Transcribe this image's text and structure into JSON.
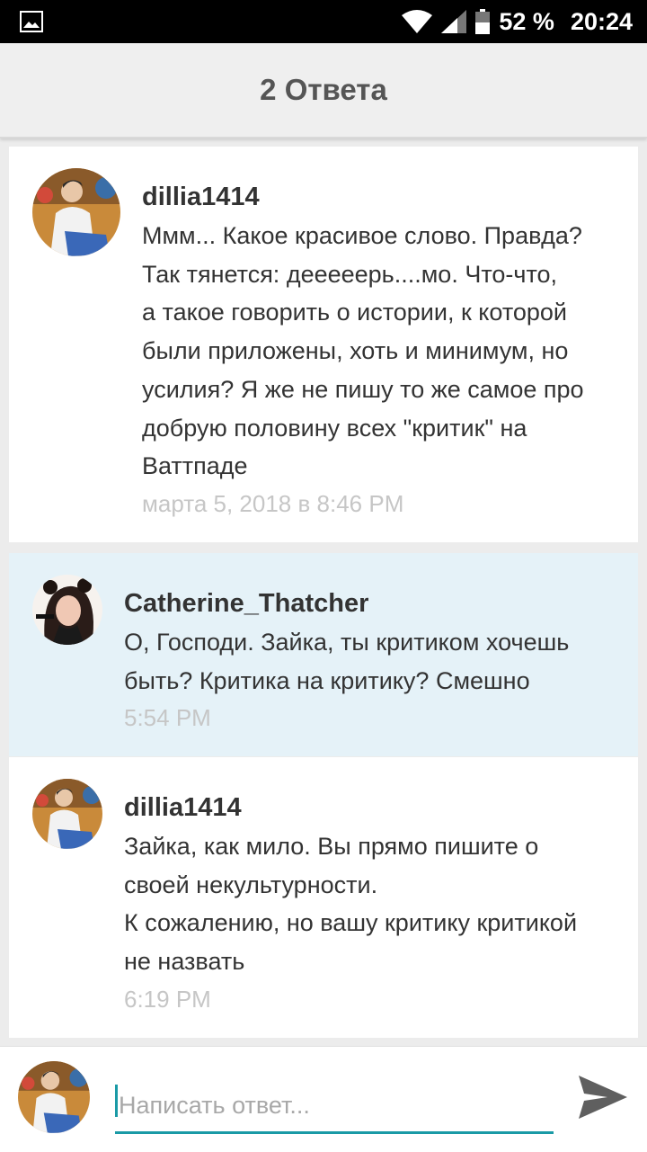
{
  "status_bar": {
    "battery": "52 %",
    "time": "20:24"
  },
  "header": {
    "title": "2 Ответа"
  },
  "comments": [
    {
      "user": "dillia1414",
      "text": "Ммм... Какое красивое слово. Правда?\nТак тянется: дееееерь....мо. Что-что,\nа такое говорить о истории, к которой\nбыли приложены, хоть и минимум, но\nусилия? Я же не пишу то же самое про\nдобрую половину всех \"критик\" на\nВаттпаде",
      "time": "марта 5, 2018 в 8:46 PM"
    },
    {
      "user": "Catherine_Thatcher",
      "text": "О, Господи. Зайка, ты критиком хочешь\nбыть? Критика на критику? Смешно",
      "time": "5:54 PM"
    },
    {
      "user": "dillia1414",
      "text": "Зайка, как мило. Вы прямо пишите о\nсвоей некультурности.\nК сожалению, но вашу критику критикой\nне назвать",
      "time": "6:19 PM"
    }
  ],
  "reply": {
    "placeholder": "Написать ответ..."
  },
  "colors": {
    "accent": "#1a9aa6",
    "highlight_bg": "#e5f2f8",
    "timestamp": "#c6c6c6"
  }
}
